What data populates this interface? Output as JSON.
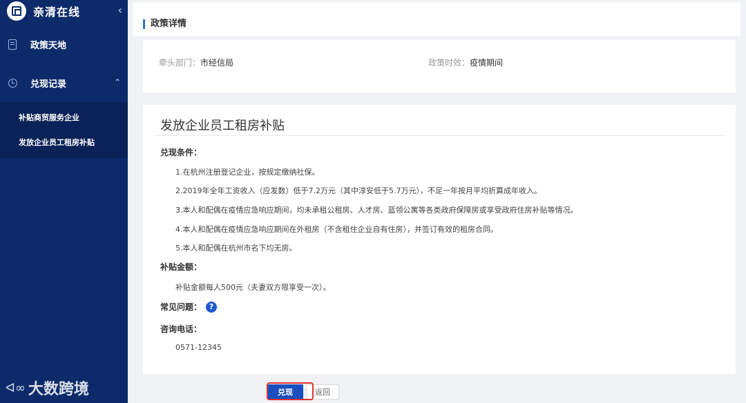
{
  "sidebar": {
    "brand": "亲清在线",
    "nav": [
      {
        "label": "政策天地"
      },
      {
        "label": "兑现记录"
      }
    ],
    "sub_items": [
      "补贴商贸服务企业",
      "发放企业员工租房补贴"
    ],
    "watermark": "大数跨境"
  },
  "main": {
    "section_title": "政策详情",
    "meta": {
      "dept_label": "牵头部门：",
      "dept_value": "市经信局",
      "period_label": "政策时效：",
      "period_value": "疫情期间"
    },
    "policy": {
      "title": "发放企业员工租房补贴",
      "conditions_label": "兑现条件：",
      "conditions": [
        "1.在杭州注册登记企业，按规定缴纳社保。",
        "2.2019年全年工资收入（应发数）低于7.2万元（其中淳安低于5.7万元），不足一年按月平均折算成年收入。",
        "3.本人和配偶在疫情应急响应期间，均未承租公租房、人才房、蓝领公寓等各类政府保障房或享受政府住房补贴等情况。",
        "4.本人和配偶在疫情应急响应期间在外租房（不含租住企业自有住房），并签订有效的租房合同。",
        "5.本人和配偶在杭州市名下均无房。"
      ],
      "amount_label": "补贴金额：",
      "amount_text": "补贴金额每人500元（夫妻双方限享受一次）。",
      "faq_label": "常见问题：",
      "phone_label": "咨询电话：",
      "phone_value": "0571-12345"
    },
    "buttons": {
      "redeem": "兑现",
      "back": "返回"
    }
  },
  "colors": {
    "sidebar_bg": "#0d2b6b",
    "accent": "#1a4fc0",
    "highlight": "#e0312b"
  }
}
